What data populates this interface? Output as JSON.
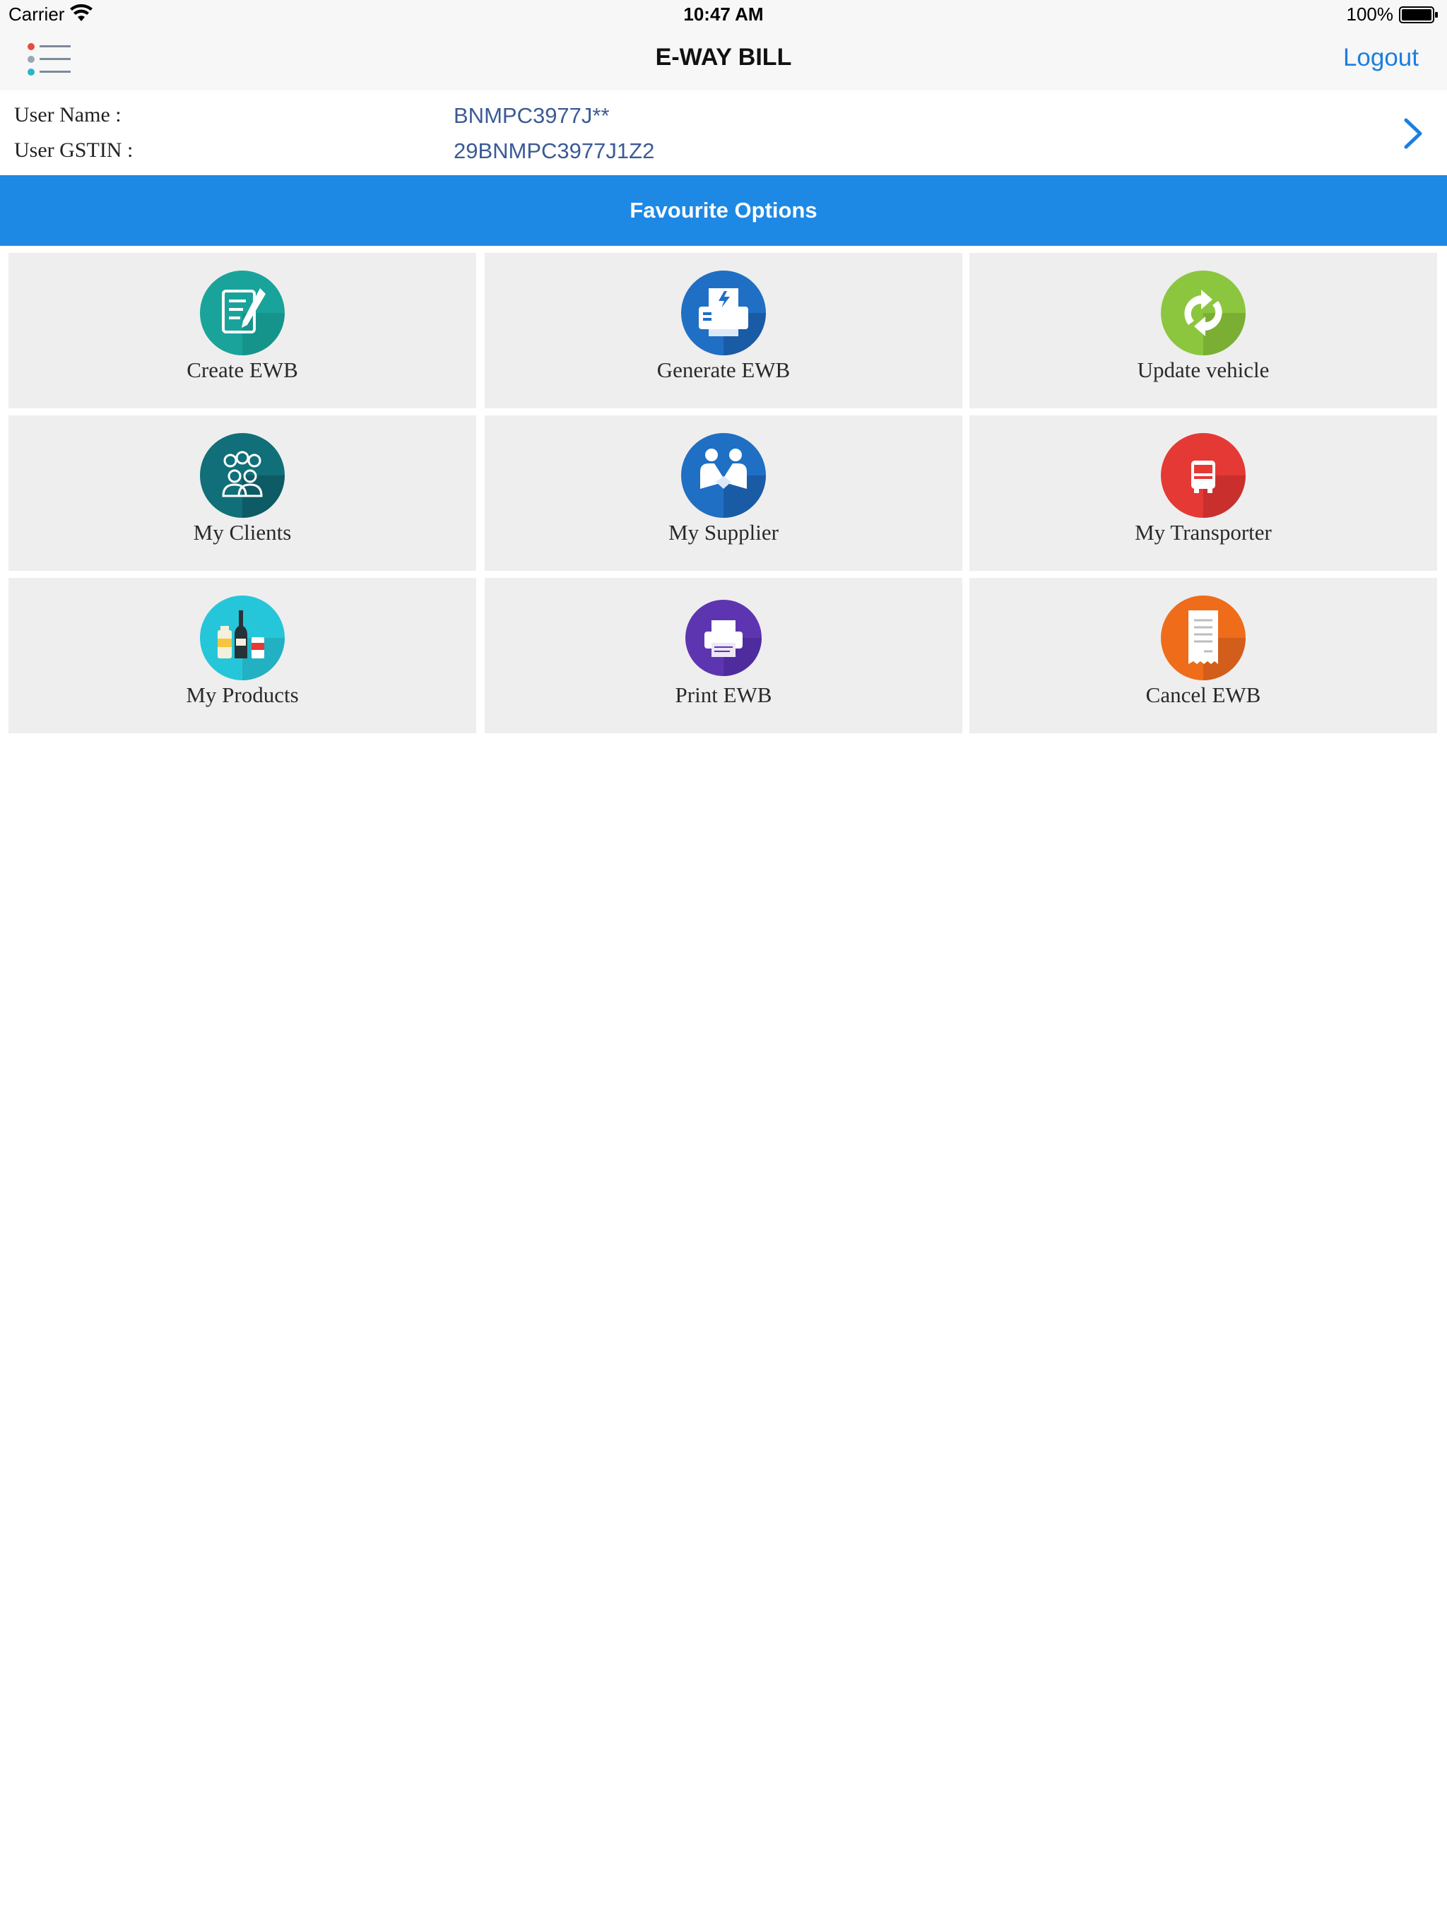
{
  "status_bar": {
    "carrier": "Carrier",
    "time": "10:47 AM",
    "battery": "100%"
  },
  "nav": {
    "title": "E-WAY BILL",
    "logout_label": "Logout"
  },
  "user": {
    "name_label": "User Name :",
    "name_value": "BNMPC3977J**",
    "gstin_label": "User GSTIN :",
    "gstin_value": "29BNMPC3977J1Z2"
  },
  "favourites": {
    "header": "Favourite Options",
    "tiles": [
      {
        "label": "Create EWB",
        "icon": "create-document-icon",
        "color": "#1aa39a"
      },
      {
        "label": "Generate EWB",
        "icon": "generate-fax-icon",
        "color": "#1f6fc4"
      },
      {
        "label": "Update vehicle",
        "icon": "refresh-arrows-icon",
        "color": "#8cc63f"
      },
      {
        "label": "My Clients",
        "icon": "people-group-icon",
        "color": "#106f78"
      },
      {
        "label": "My Supplier",
        "icon": "handshake-icon",
        "color": "#1f6fc4"
      },
      {
        "label": "My Transporter",
        "icon": "truck-icon",
        "color": "#e53935"
      },
      {
        "label": "My Products",
        "icon": "products-bottles-icon",
        "color": "#26c6da"
      },
      {
        "label": "Print EWB",
        "icon": "printer-icon",
        "color": "#5e35b1"
      },
      {
        "label": "Cancel EWB",
        "icon": "receipt-icon",
        "color": "#ef6c1a"
      }
    ]
  }
}
